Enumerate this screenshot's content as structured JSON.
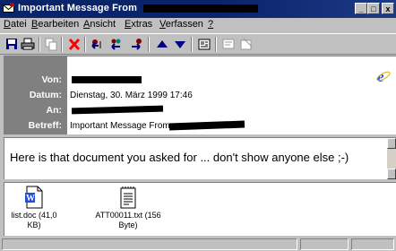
{
  "window": {
    "title": "Important Message From",
    "controls": {
      "minimize": "_",
      "maximize": "□",
      "close": "x"
    }
  },
  "menu": {
    "items": [
      "Datei",
      "Bearbeiten",
      "Ansicht",
      "Extras",
      "Verfassen",
      "?"
    ]
  },
  "toolbar": {
    "buttons": [
      "save-icon",
      "print-icon",
      "copy-icon",
      "delete-icon",
      "reply-icon",
      "reply-all-icon",
      "forward-icon",
      "previous-icon",
      "next-icon",
      "address-book-icon",
      "attachment-icon",
      "properties-icon"
    ]
  },
  "header": {
    "labels": {
      "from": "Von:",
      "date": "Datum:",
      "to": "An:",
      "subject": "Betreff:"
    },
    "date_value": "Dienstag, 30. März 1999 17:46",
    "subject_value": "Important Message From"
  },
  "message": {
    "body": "Here is that document you asked for ... don't show anyone else ;-)"
  },
  "attachments": [
    {
      "name": "list.doc (41,0 KB)",
      "icon": "word-document-icon"
    },
    {
      "name": "ATT00011.txt (156 Byte)",
      "icon": "text-file-icon"
    }
  ],
  "colors": {
    "title_bar": "#0a246a",
    "header_label_bg": "#808080",
    "window_bg": "#c0c0c0",
    "delete_red": "#ff0000"
  }
}
